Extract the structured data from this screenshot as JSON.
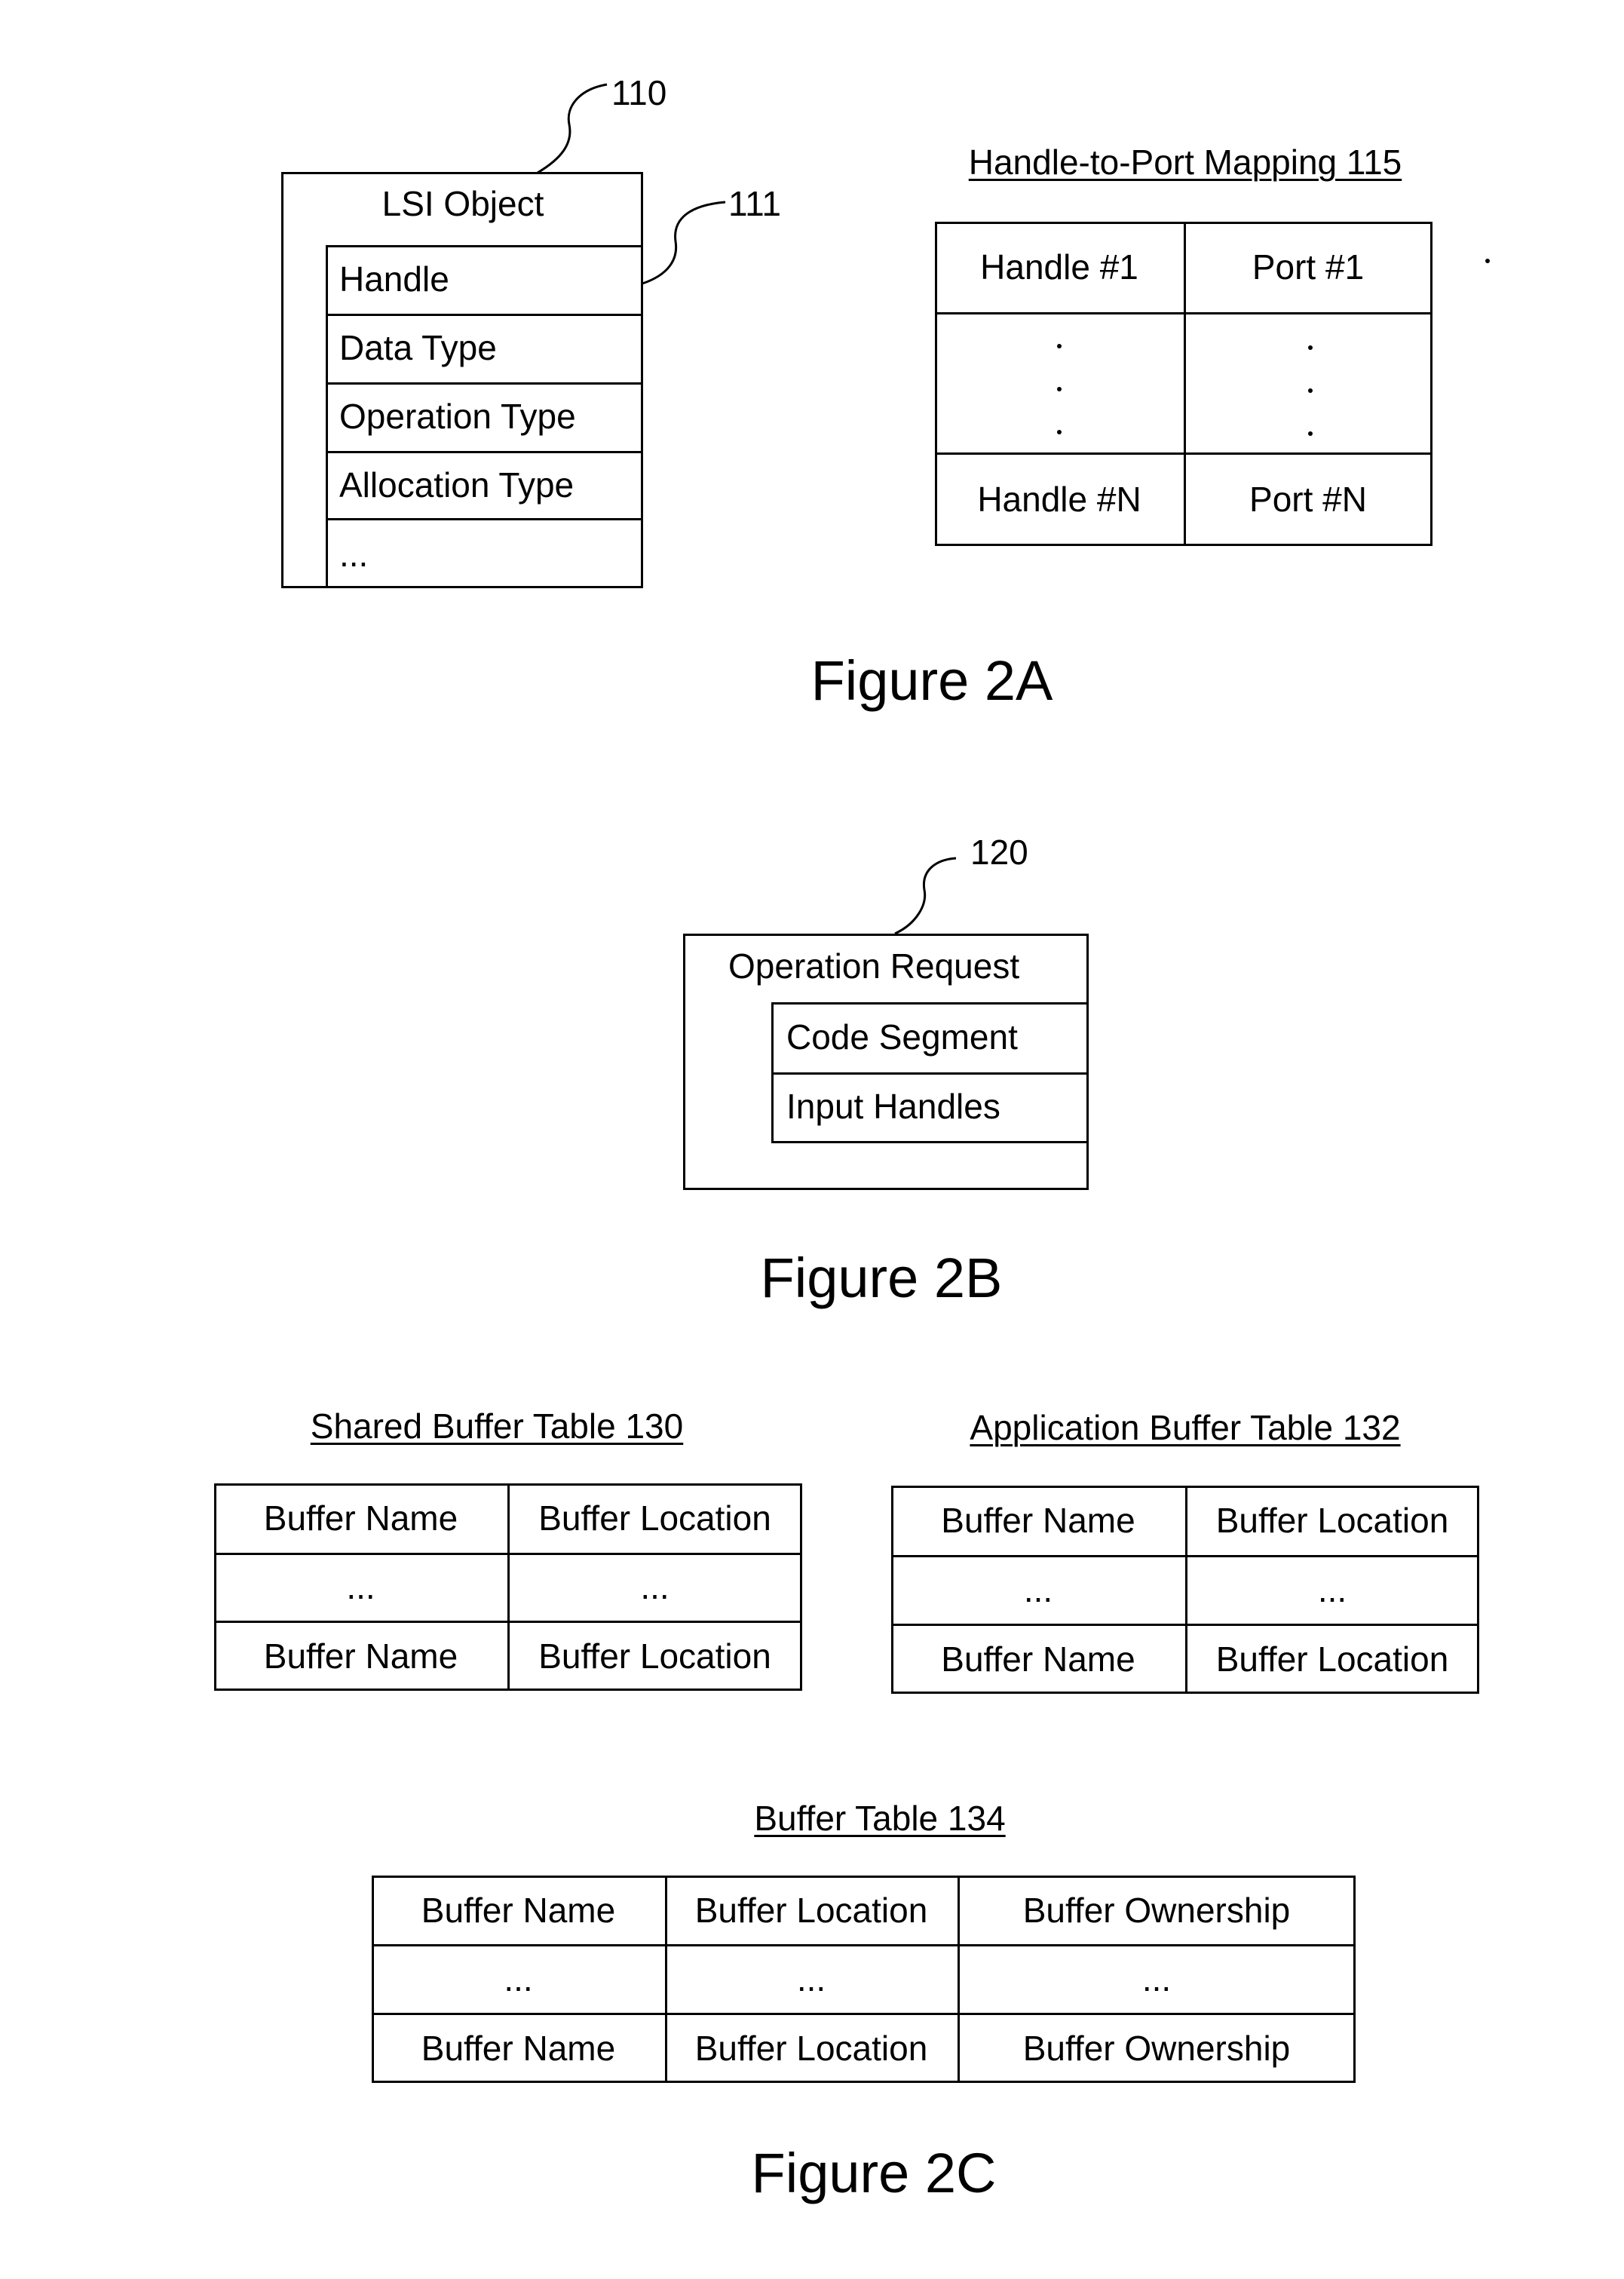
{
  "figure_2a": {
    "caption": "Figure 2A",
    "lsi_object": {
      "ref_label": "110",
      "fields_ref_label": "111",
      "title": "LSI Object",
      "fields": [
        "Handle",
        "Data Type",
        "Operation Type",
        "Allocation Type",
        "..."
      ]
    },
    "handle_to_port_mapping": {
      "title": "Handle-to-Port Mapping 115",
      "rows": [
        [
          "Handle #1",
          "Port #1"
        ],
        [
          "·",
          "·"
        ],
        [
          "Handle #N",
          "Port #N"
        ]
      ]
    }
  },
  "figure_2b": {
    "caption": "Figure 2B",
    "operation_request": {
      "ref_label": "120",
      "title": "Operation Request",
      "fields": [
        "Code Segment",
        "Input Handles"
      ]
    }
  },
  "figure_2c": {
    "caption": "Figure 2C",
    "shared_buffer_table": {
      "title": "Shared Buffer Table 130",
      "rows": [
        [
          "Buffer Name",
          "Buffer Location"
        ],
        [
          "...",
          "..."
        ],
        [
          "Buffer Name",
          "Buffer Location"
        ]
      ]
    },
    "application_buffer_table": {
      "title": "Application Buffer Table 132",
      "rows": [
        [
          "Buffer Name",
          "Buffer Location"
        ],
        [
          "...",
          "..."
        ],
        [
          "Buffer Name",
          "Buffer Location"
        ]
      ]
    },
    "buffer_table": {
      "title": "Buffer Table 134",
      "rows": [
        [
          "Buffer Name",
          "Buffer Location",
          "Buffer Ownership"
        ],
        [
          "...",
          "...",
          "..."
        ],
        [
          "Buffer Name",
          "Buffer Location",
          "Buffer Ownership"
        ]
      ]
    }
  }
}
